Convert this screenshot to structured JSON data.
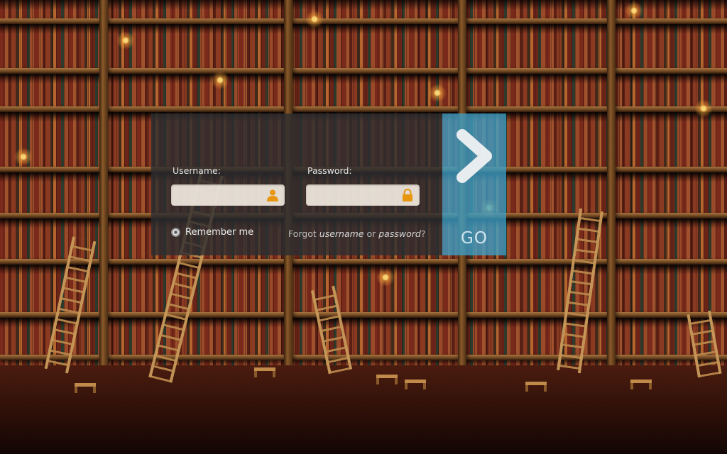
{
  "background": {
    "scene": "library bookshelves with ladders and candles"
  },
  "login": {
    "username_label": "Username:",
    "username_value": "",
    "username_icon": "user-icon",
    "password_label": "Password:",
    "password_value": "",
    "password_icon": "lock-icon",
    "remember_label": "Remember me",
    "forgot_prefix": "Forgot ",
    "forgot_username": "username",
    "forgot_or": " or ",
    "forgot_password": "password",
    "forgot_suffix": "?"
  },
  "go": {
    "label": "GO",
    "icon": "chevron-right-icon",
    "color": "#3ca0c8"
  },
  "colors": {
    "accent": "#f0a020",
    "panel": "#2d2d30"
  }
}
